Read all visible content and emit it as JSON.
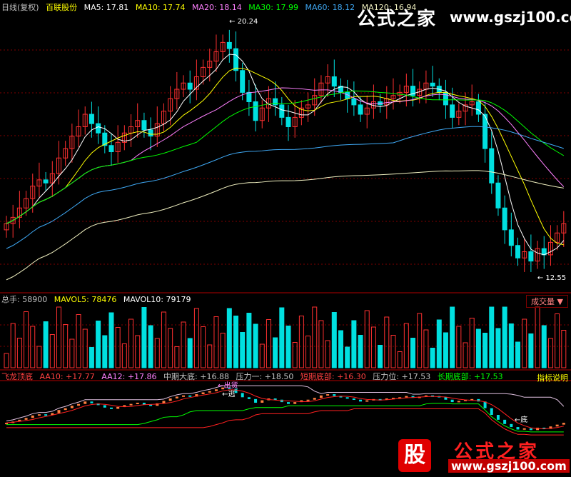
{
  "price_header": {
    "period": "日线(复权)",
    "stock_name": "百联股份",
    "ma5": "MA5: 17.81",
    "ma10": "MA10: 17.74",
    "ma20": "MA20: 18.14",
    "ma30": "MA30: 17.99",
    "ma60": "MA60: 18.12",
    "ma120": "MA120: 16.94"
  },
  "volume_header": {
    "total": "总手: 58900",
    "mavol5": "MAVOL5: 78476",
    "mavol10": "MAVOL10: 79179",
    "dropdown": "成交量 ▼"
  },
  "indicator_header": {
    "name": "飞龙顶底",
    "aa10": "AA10: +17.77",
    "aa12": "AA12: +17.86",
    "mid_bottom": "中期大底: +16.88",
    "press1": "压力一: +18.50",
    "short_bottom": "短期底部: +16.30",
    "press_pos": "压力位: +17.53",
    "long_bottom": "长期底部: +17.53",
    "help": "指标说明"
  },
  "annotations": {
    "high": "20.24",
    "low": "12.55",
    "sell": "出货",
    "escape": "逃",
    "bottom": "底"
  },
  "watermark": {
    "title": "公式之家",
    "url": "www.gszj100.com",
    "logo_char": "股"
  },
  "colors": {
    "up": "#ff3030",
    "down": "#00e0e0",
    "ma5": "#ffffff",
    "ma10": "#ffff00",
    "ma20": "#ff80ff",
    "ma30": "#00ff00",
    "ma60": "#3fa9f5",
    "ma120": "#f0f0c0"
  },
  "chart_data": {
    "type": "candlestick",
    "ylim": [
      12.0,
      20.8
    ],
    "close": [
      14.1,
      14.3,
      14.6,
      14.9,
      15.3,
      15.5,
      15.4,
      15.7,
      16.2,
      16.5,
      16.9,
      17.2,
      17.6,
      17.3,
      17.0,
      16.6,
      16.4,
      16.7,
      17.0,
      17.2,
      17.4,
      17.1,
      16.9,
      17.3,
      17.7,
      18.1,
      18.4,
      18.6,
      18.4,
      18.8,
      19.1,
      19.3,
      19.6,
      19.9,
      19.7,
      19.0,
      18.3,
      18.0,
      17.4,
      17.8,
      18.1,
      17.9,
      17.5,
      17.2,
      17.5,
      17.8,
      17.9,
      18.2,
      18.6,
      18.8,
      18.5,
      18.3,
      18.1,
      17.9,
      17.6,
      17.8,
      18.0,
      17.9,
      18.1,
      18.2,
      18.3,
      18.5,
      18.2,
      18.4,
      18.6,
      18.5,
      18.3,
      17.9,
      17.5,
      17.7,
      17.9,
      18.0,
      17.6,
      16.5,
      15.4,
      14.6,
      13.9,
      13.4,
      13.0,
      13.2,
      12.9,
      13.3,
      13.1,
      13.5,
      13.8,
      14.1
    ]
  }
}
